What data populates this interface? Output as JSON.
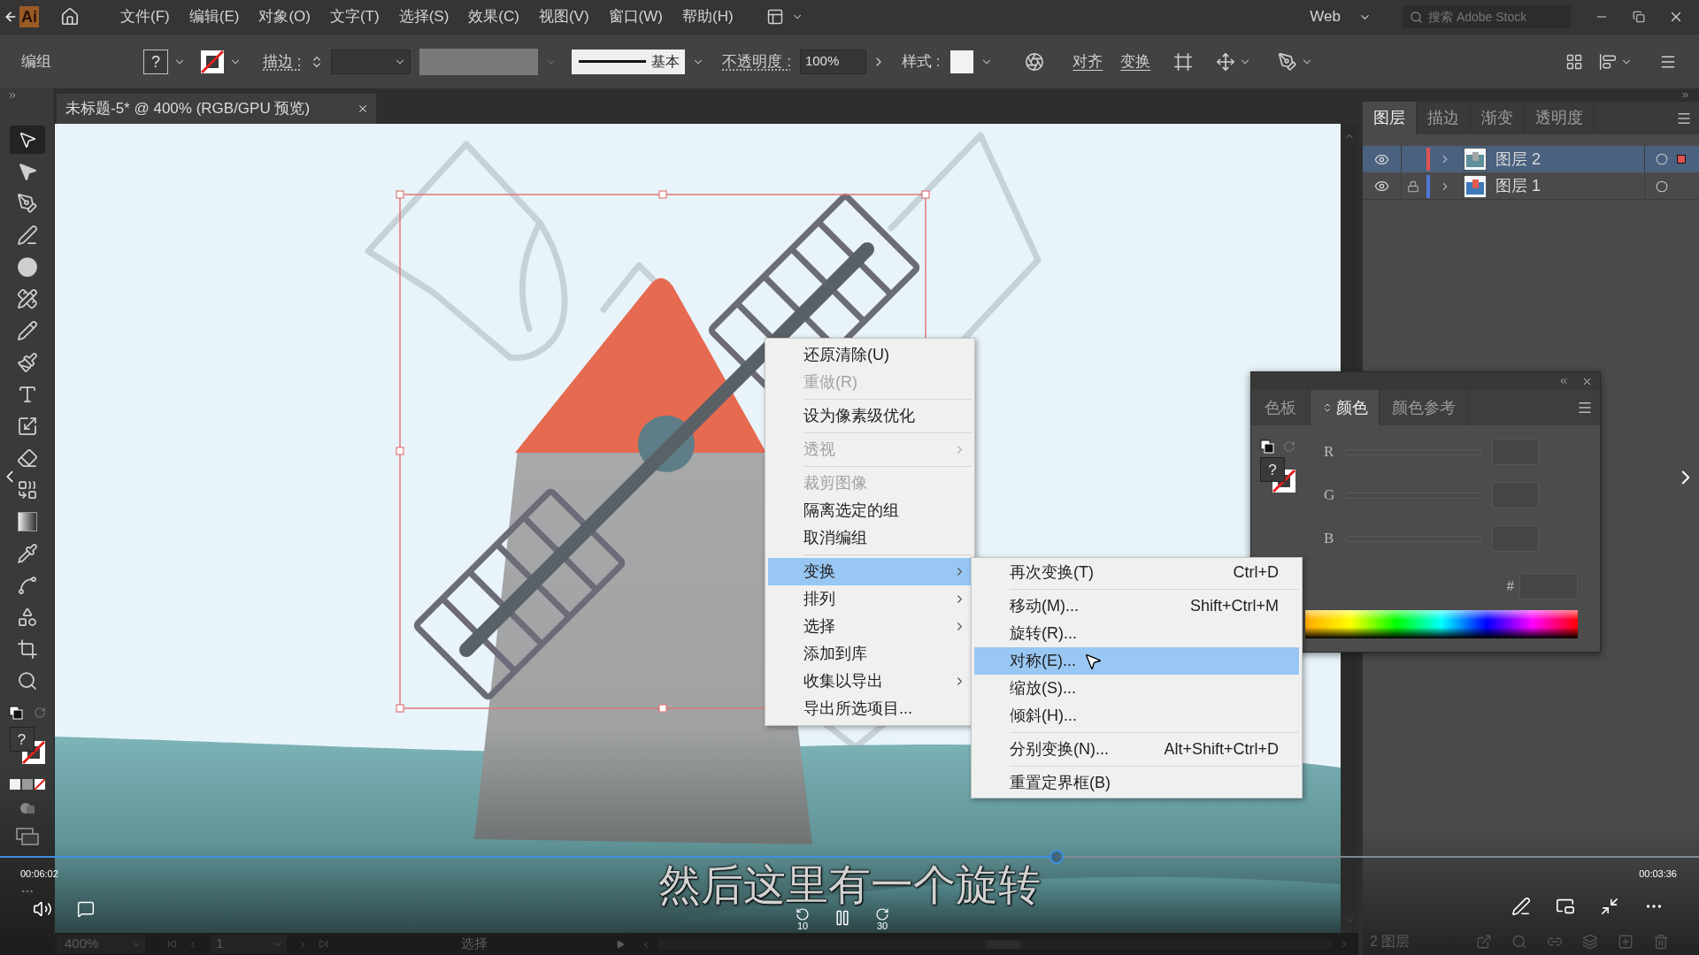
{
  "menu_bar": {
    "logo": "Ai",
    "items": [
      "文件(F)",
      "编辑(E)",
      "对象(O)",
      "文字(T)",
      "选择(S)",
      "效果(C)",
      "视图(V)",
      "窗口(W)",
      "帮助(H)"
    ],
    "workspace": "Web",
    "search": {
      "placeholder": "搜索 Adobe Stock"
    }
  },
  "control_bar": {
    "selection": "编组",
    "fill_indicator": "?",
    "stroke_label": "描边 :",
    "brush": "基本",
    "opacity_label": "不透明度 :",
    "opacity": "100%",
    "style_label": "样式 :",
    "align": "对齐",
    "transform": "变换"
  },
  "document_tab": {
    "title": "未标题-5* @ 400% (RGB/GPU 预览)"
  },
  "toolbar": {
    "tools": [
      {
        "selected": true
      },
      {
        "selected": false
      },
      {
        "selected": false
      },
      {
        "selected": false
      },
      {
        "selected": false
      },
      {
        "selected": false
      },
      {
        "selected": false
      },
      {
        "selected": false
      },
      {
        "selected": false
      },
      {
        "selected": false
      },
      {
        "selected": false
      },
      {
        "selected": false
      },
      {
        "selected": false
      },
      {
        "selected": false
      },
      {
        "selected": false
      },
      {
        "selected": false
      },
      {
        "selected": false
      },
      {
        "selected": false
      }
    ],
    "fill_indicator": "?"
  },
  "layers_panel": {
    "tabs": [
      {
        "label": "图层",
        "selected": true
      },
      {
        "label": "描边",
        "selected": false
      },
      {
        "label": "渐变",
        "selected": false
      },
      {
        "label": "透明度",
        "selected": false
      }
    ],
    "layers": [
      {
        "name": "图层 2",
        "selected": true,
        "locked": false,
        "color": "#e0524f"
      },
      {
        "name": "图层 1",
        "selected": false,
        "locked": true,
        "color": "#4f76d9"
      }
    ],
    "footer": "2 图层"
  },
  "color_panel": {
    "tabs": [
      {
        "label": "色板",
        "selected": false
      },
      {
        "label": "颜色",
        "selected": true
      },
      {
        "label": "颜色参考",
        "selected": false
      }
    ],
    "fill_indicator": "?",
    "channels": [
      {
        "label": "R"
      },
      {
        "label": "G"
      },
      {
        "label": "B"
      }
    ],
    "hex_label": "#"
  },
  "context_menu": {
    "groups": [
      [
        {
          "label": "还原清除(U)",
          "disabled": false,
          "selected": false,
          "submenu": false
        },
        {
          "label": "重做(R)",
          "disabled": true,
          "selected": false,
          "submenu": false
        }
      ],
      [
        {
          "label": "设为像素级优化",
          "disabled": false,
          "selected": false,
          "submenu": false
        }
      ],
      [
        {
          "label": "透视",
          "disabled": true,
          "selected": false,
          "submenu": true
        }
      ],
      [
        {
          "label": "裁剪图像",
          "disabled": true,
          "selected": false,
          "submenu": false
        },
        {
          "label": "隔离选定的组",
          "disabled": false,
          "selected": false,
          "submenu": false
        },
        {
          "label": "取消编组",
          "disabled": false,
          "selected": false,
          "submenu": false
        }
      ],
      [
        {
          "label": "变换",
          "disabled": false,
          "selected": true,
          "submenu": true
        },
        {
          "label": "排列",
          "disabled": false,
          "selected": false,
          "submenu": true
        },
        {
          "label": "选择",
          "disabled": false,
          "selected": false,
          "submenu": true
        },
        {
          "label": "添加到库",
          "disabled": false,
          "selected": false,
          "submenu": false
        },
        {
          "label": "收集以导出",
          "disabled": false,
          "selected": false,
          "submenu": true
        },
        {
          "label": "导出所选项目...",
          "disabled": false,
          "selected": false,
          "submenu": false
        }
      ]
    ]
  },
  "submenu": {
    "groups": [
      [
        {
          "label": "再次变换(T)",
          "shortcut": "Ctrl+D",
          "selected": false
        }
      ],
      [
        {
          "label": "移动(M)...",
          "shortcut": "Shift+Ctrl+M",
          "selected": false
        },
        {
          "label": "旋转(R)...",
          "selected": false
        },
        {
          "label": "对称(E)...",
          "selected": true
        },
        {
          "label": "缩放(S)...",
          "selected": false
        },
        {
          "label": "倾斜(H)...",
          "selected": false
        }
      ],
      [
        {
          "label": "分别变换(N)...",
          "shortcut": "Alt+Shift+Ctrl+D",
          "selected": false
        }
      ],
      [
        {
          "label": "重置定界框(B)",
          "selected": false
        }
      ]
    ]
  },
  "status_bar": {
    "zoom": "400%",
    "artboard": "1",
    "tool": "选择"
  },
  "video_player": {
    "elapsed": "00:06:02",
    "remaining": "00:03:36",
    "subtitle": "然后这里有一个旋转",
    "level": 0.622,
    "skip_back": "10",
    "skip_forward": "30"
  }
}
